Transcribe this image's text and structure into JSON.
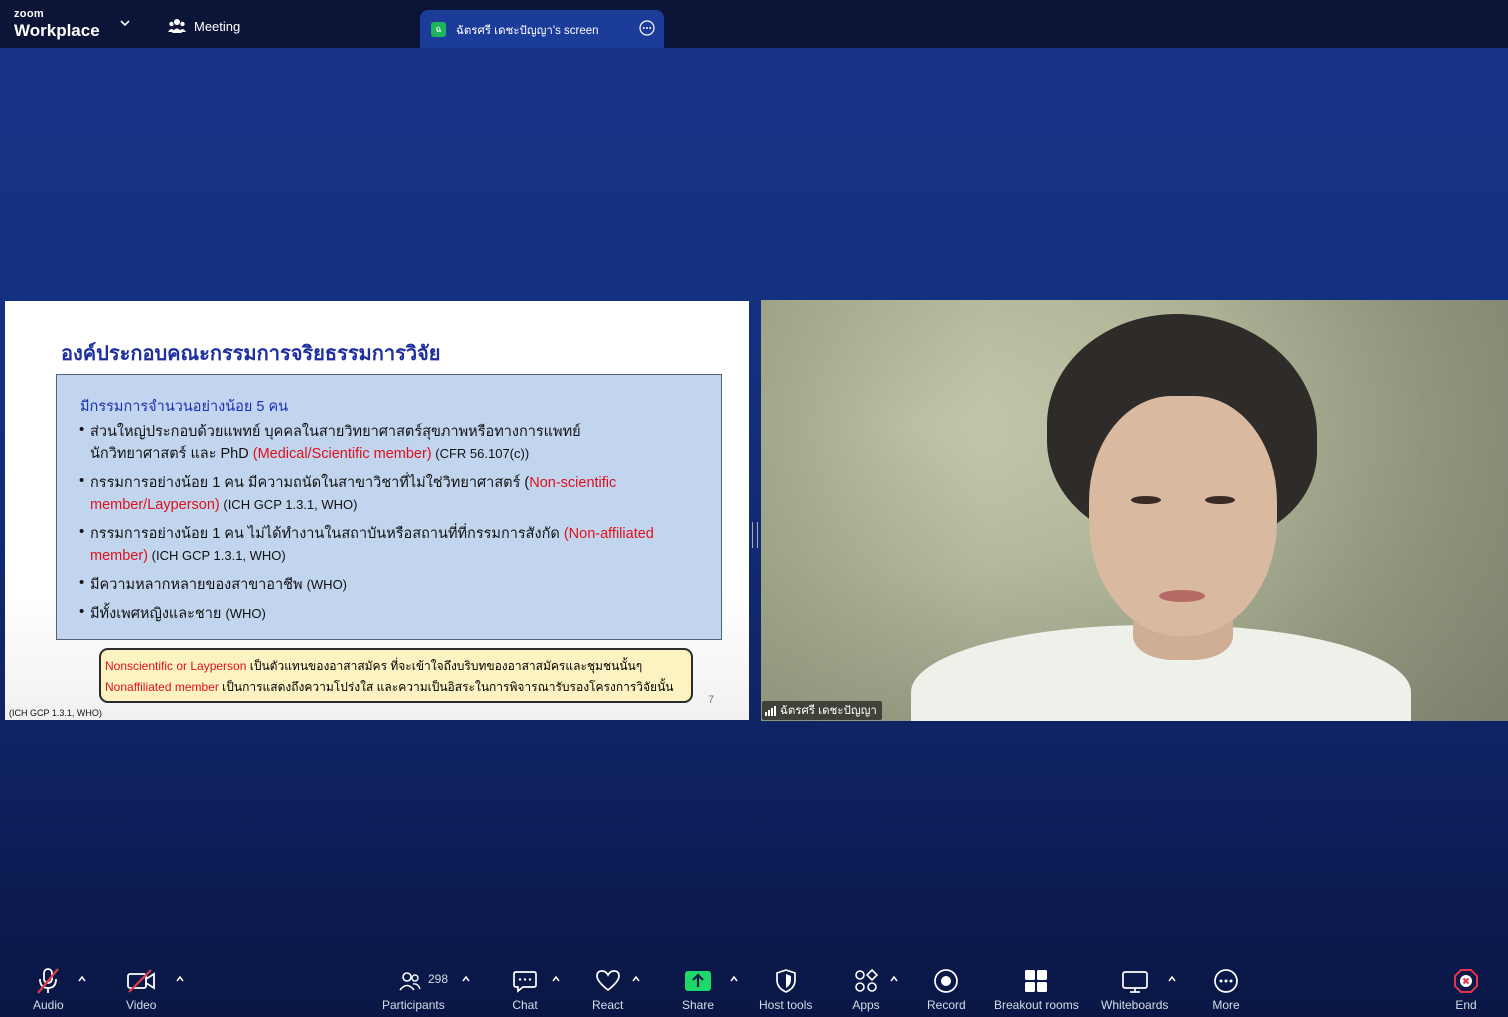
{
  "app": {
    "brand_small": "zoom",
    "brand_large": "Workplace",
    "meeting_tab_label": "Meeting",
    "share_tab_label": "ฉัตรศรี เดชะปัญญา's screen",
    "share_tab_icon": "ฉ"
  },
  "slide": {
    "title": "องค์ประกอบคณะกรรมการจริยธรรมการวิจัย",
    "box_heading": "มีกรรมการจำนวนอย่างน้อย 5 คน",
    "bullets": [
      {
        "line1": "ส่วนใหญ่ประกอบด้วยแพทย์ บุคคลในสายวิทยาศาสตร์สุขภาพหรือทางการแพทย์",
        "line2_pre": "นักวิทยาศาสตร์ และ PhD ",
        "line2_red": "(Medical/Scientific member)",
        "line2_ref": " (CFR 56.107(c))"
      },
      {
        "line1_pre": "กรรมการอย่างน้อย 1 คน มีความถนัดในสาขาวิชาที่ไม่ใช่วิทยาศาสตร์ (",
        "line1_red": "Non-scientific",
        "line2_red": "member/Layperson)",
        "line2_ref": " (ICH GCP 1.3.1, WHO)"
      },
      {
        "line1_pre": "กรรมการอย่างน้อย 1 คน ไม่ได้ทำงานในสถาบันหรือสถานที่ที่กรรมการสังกัด ",
        "line1_red": "(Non-affiliated",
        "line2_red": "member)",
        "line2_ref": " (ICH GCP 1.3.1, WHO)"
      },
      {
        "line1_pre": "มีความหลากหลายของสาขาอาชีพ ",
        "line1_ref": "(WHO)"
      },
      {
        "line1_pre": "มีทั้งเพศหญิงและชาย ",
        "line1_ref": "(WHO)"
      }
    ],
    "note_line1_red": "Nonscientific or Layperson",
    "note_line1_text": " เป็นตัวแทนของอาสาสมัคร ที่จะเข้าใจถึงบริบทของอาสาสมัครและชุมชนนั้นๆ",
    "note_line2_red": "Nonaffiliated member",
    "note_line2_text": " เป็นการแสดงถึงความโปร่งใส และความเป็นอิสระในการพิจารณารับรองโครงการวิจัยนั้น",
    "page_number": "7",
    "footer_ref": "(ICH GCP 1.3.1, WHO)"
  },
  "video": {
    "participant_name": "ฉัตรศรี เดชะปัญญา"
  },
  "toolbar": {
    "audio_label": "Audio",
    "video_label": "Video",
    "participants_label": "Participants",
    "participants_count": "298",
    "chat_label": "Chat",
    "react_label": "React",
    "share_label": "Share",
    "host_tools_label": "Host tools",
    "apps_label": "Apps",
    "record_label": "Record",
    "breakout_label": "Breakout rooms",
    "whiteboards_label": "Whiteboards",
    "more_label": "More",
    "end_label": "End"
  },
  "colors": {
    "background": "#14307f",
    "topbar": "#0c1538",
    "share_tab": "#1c3c9a",
    "share_green": "#1fb35b",
    "slide_title": "#1e2f9f",
    "slide_box": "#c2d5ee",
    "red_text": "#e0101a",
    "note_bg": "#fdf3c2",
    "mute_red": "#e23b4a",
    "end_red": "#e8334a"
  }
}
